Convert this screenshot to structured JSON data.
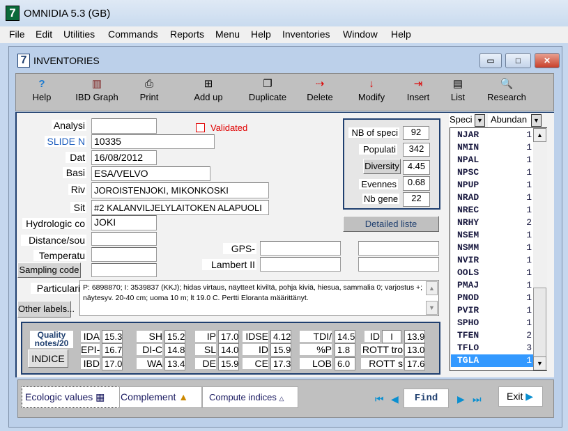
{
  "app": {
    "title": "OMNIDIA 5.3 (GB)",
    "icon_glyph": "7"
  },
  "menu": [
    "File",
    "Edit",
    "Utilities",
    "Commands",
    "Reports",
    "Menu",
    "Help",
    "Inventories",
    "Window",
    "Help"
  ],
  "window": {
    "title": "INVENTORIES",
    "icon_glyph": "7",
    "minimize": "▭",
    "maximize": "□",
    "close": "✕"
  },
  "toolbar": [
    {
      "label": "Help",
      "icon": "question-icon",
      "glyph": "?"
    },
    {
      "label": "IBD Graph",
      "icon": "bar-chart-icon",
      "glyph": "▥"
    },
    {
      "label": "Print",
      "icon": "printer-icon",
      "glyph": "⎙"
    },
    {
      "label": "Add up",
      "icon": "add-up-icon",
      "glyph": "⊞"
    },
    {
      "label": "Duplicate",
      "icon": "duplicate-icon",
      "glyph": "❐"
    },
    {
      "label": "Delete",
      "icon": "delete-icon",
      "glyph": "⇢"
    },
    {
      "label": "Modify",
      "icon": "modify-icon",
      "glyph": "↓"
    },
    {
      "label": "Insert",
      "icon": "insert-icon",
      "glyph": "⇥"
    },
    {
      "label": "List",
      "icon": "list-icon",
      "glyph": "▤"
    },
    {
      "label": "Research",
      "icon": "research-icon",
      "glyph": "🔍"
    }
  ],
  "form": {
    "analysis": {
      "label": "Analysi",
      "value": ""
    },
    "slide": {
      "label": "SLIDE N",
      "value": "10335"
    },
    "date": {
      "label": "Dat",
      "value": "16/08/2012"
    },
    "basin": {
      "label": "Basi",
      "value": "ESA/VELVO"
    },
    "river": {
      "label": "Riv",
      "value": "JOROISTENJOKI, MIKONKOSKI"
    },
    "site": {
      "label": "Sit",
      "value": "#2 KALANVILJELYLAITOKEN ALAPUOLI"
    },
    "hydro": {
      "label": "Hydrologic co",
      "value": "JOKI"
    },
    "distance": {
      "label": "Distance/sou",
      "value": ""
    },
    "temperature": {
      "label": "Temperatu",
      "value": ""
    },
    "sampling_code": {
      "label": "Sampling code",
      "value": ""
    },
    "validated": {
      "label": "Validated",
      "checked": false
    },
    "gps": {
      "label": "GPS-",
      "value1": "",
      "value2": ""
    },
    "lambert": {
      "label": "Lambert II",
      "value1": "",
      "value2": ""
    },
    "particularities": {
      "label": "Particulariti",
      "value": "P: 6898870; I: 3539837 (KKJ); hidas virtaus, näytteet kiviltä, pohja kiviä, hiesua, sammalia 0; varjostus +; näytesyv. 20-40 cm; uoma 10 m; lt 19.0 C.  Pertti Eloranta määrittänyt."
    },
    "other_labels": "Other labels..."
  },
  "stats": {
    "nb_species": {
      "label": "NB of speci",
      "value": "92"
    },
    "population": {
      "label": "Populati",
      "value": "342"
    },
    "diversity": {
      "label": "Diversity",
      "value": "4.45"
    },
    "evenness": {
      "label": "Evennes",
      "value": "0.68"
    },
    "nb_genera": {
      "label": "Nb gene",
      "value": "22"
    },
    "detailed": "Detailed liste"
  },
  "indices": {
    "quality_label": "Quality notes/20",
    "indice_button": "INDICE",
    "items": [
      {
        "label": "IDA",
        "value": "15.3"
      },
      {
        "label": "EPI-",
        "value": "16.7"
      },
      {
        "label": "IBD",
        "value": "17.0"
      },
      {
        "label": "SH",
        "value": "15.2"
      },
      {
        "label": "DI-C",
        "value": "14.8"
      },
      {
        "label": "WA",
        "value": "13.4"
      },
      {
        "label": "IP",
        "value": "17.0"
      },
      {
        "label": "SL",
        "value": "14.0"
      },
      {
        "label": "DE",
        "value": "15.9"
      },
      {
        "label": "IDSE",
        "value": "4.12"
      },
      {
        "label": "ID",
        "value": "15.9"
      },
      {
        "label": "CE",
        "value": "17.3"
      },
      {
        "label": "TDI/",
        "value": "14.5"
      },
      {
        "label": "%P",
        "value": "1.8"
      },
      {
        "label": "LOB",
        "value": "6.0"
      },
      {
        "label": "ID",
        "value": "13.9",
        "class": "I"
      },
      {
        "label": "ROTT tro",
        "value": "13.0"
      },
      {
        "label": "ROTT s",
        "value": "17.6"
      }
    ]
  },
  "species_list": {
    "col1": "Speci",
    "col2": "Abundan",
    "rows": [
      [
        "NJAR",
        "1"
      ],
      [
        "NMIN",
        "1"
      ],
      [
        "NPAL",
        "1"
      ],
      [
        "NPSC",
        "1"
      ],
      [
        "NPUP",
        "1"
      ],
      [
        "NRAD",
        "1"
      ],
      [
        "NREC",
        "1"
      ],
      [
        "NRHY",
        "2"
      ],
      [
        "NSEM",
        "1"
      ],
      [
        "NSMM",
        "1"
      ],
      [
        "NVIR",
        "1"
      ],
      [
        "OOLS",
        "1"
      ],
      [
        "PMAJ",
        "1"
      ],
      [
        "PNOD",
        "1"
      ],
      [
        "PVIR",
        "1"
      ],
      [
        "SPHO",
        "1"
      ],
      [
        "TFEN",
        "2"
      ],
      [
        "TFLO",
        "3"
      ],
      [
        "TGLA",
        "1"
      ]
    ],
    "selected": "TGLA"
  },
  "bottom": {
    "ecologic": "Ecologic values",
    "complement": "Complement",
    "compute": "Compute indices",
    "find": "Find",
    "exit": "Exit"
  },
  "colors": {
    "frame_blue": "#1f3f6f",
    "selection": "#3399ff",
    "validated_red": "#e00000",
    "slide_label": "#1f5fbf"
  }
}
